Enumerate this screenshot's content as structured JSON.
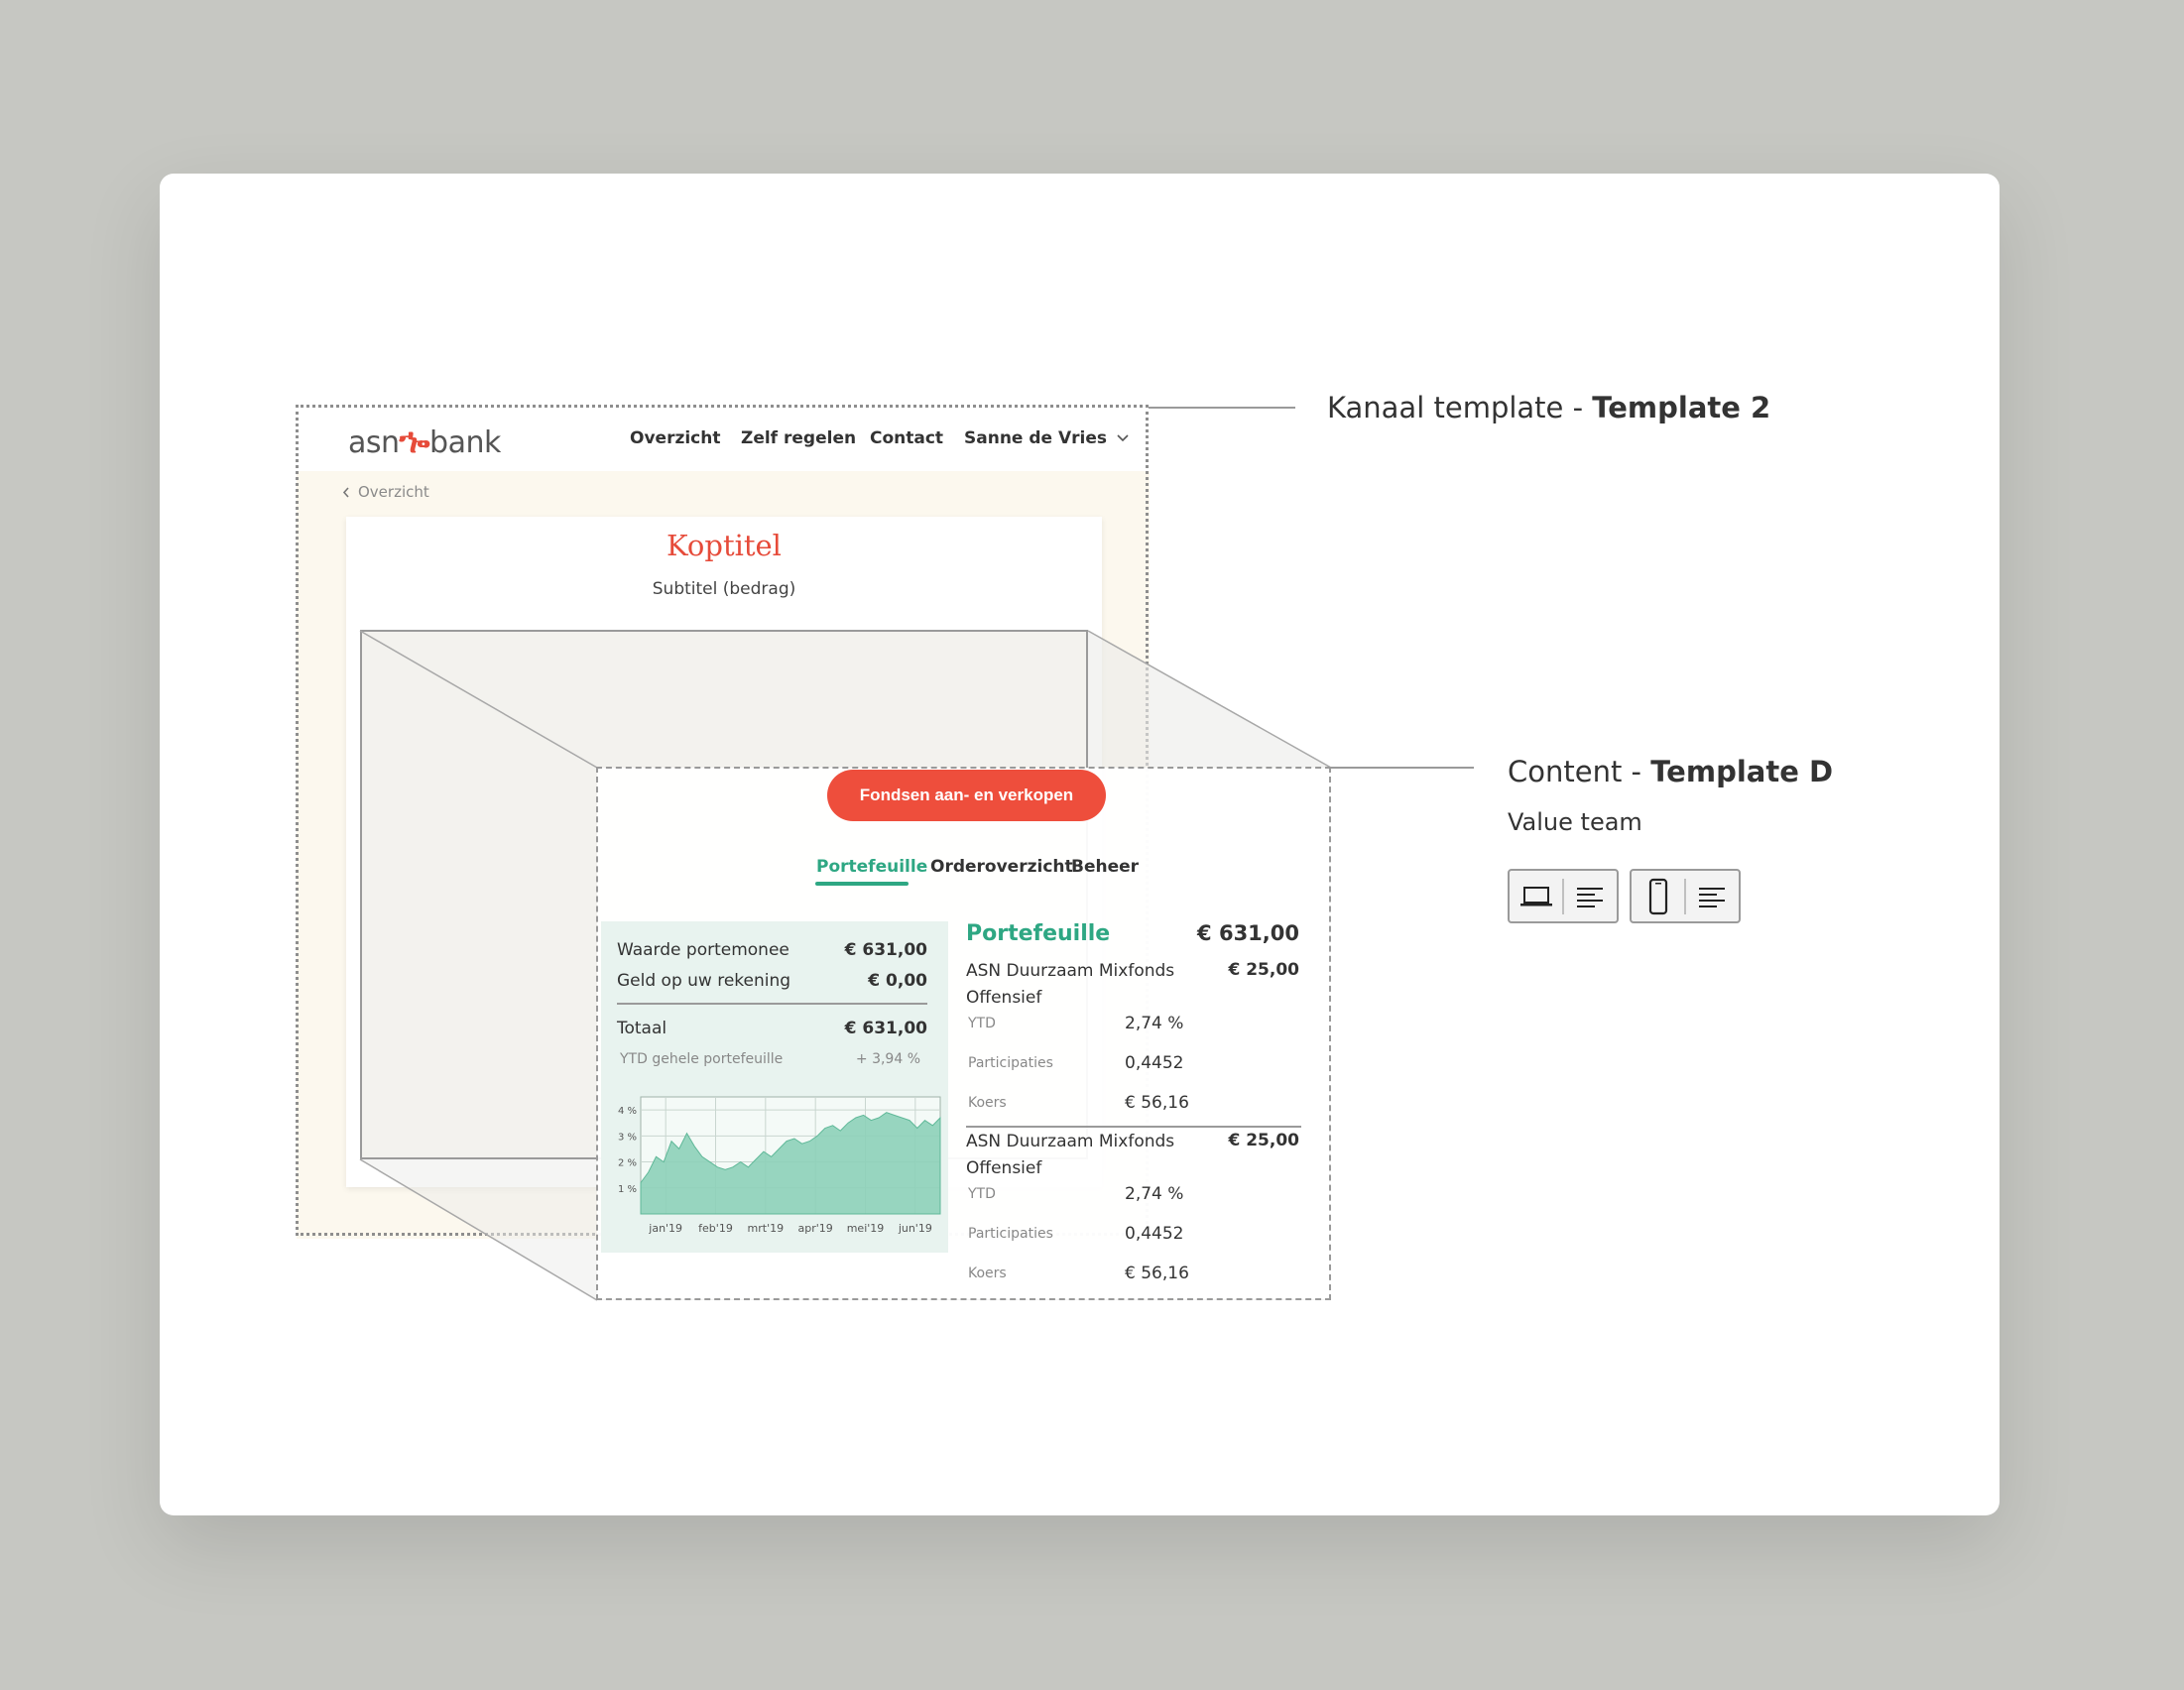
{
  "browser": {
    "logo_left": "asn",
    "logo_right": "bank",
    "nav": [
      "Overzicht",
      "Zelf regelen",
      "Contact",
      "Sanne de Vries"
    ],
    "breadcrumb": "Overzicht",
    "title": "Koptitel",
    "subtitle": "Subtitel (bedrag)"
  },
  "content": {
    "cta_label": "Fondsen aan- en verkopen",
    "tabs": [
      "Portefeuille",
      "Orderoverzicht",
      "Beheer"
    ],
    "active_tab": 0,
    "summary": {
      "rows": [
        {
          "label": "Waarde portemonee",
          "value": "€ 631,00"
        },
        {
          "label": "Geld op uw rekening",
          "value": "€ 0,00"
        }
      ],
      "total_label": "Totaal",
      "total_value": "€ 631,00",
      "ytd_label": "YTD gehele portefeuille",
      "ytd_value": "+ 3,94 %"
    },
    "portfolio": {
      "title": "Portefeuille",
      "total": "€ 631,00",
      "funds": [
        {
          "name": "ASN Duurzaam Mixfonds Offensief",
          "amount": "€ 25,00",
          "ytd_label": "YTD",
          "ytd": "2,74 %",
          "part_label": "Participaties",
          "participaties": "0,4452",
          "koers_label": "Koers",
          "koers": "€ 56,16"
        },
        {
          "name": "ASN Duurzaam Mixfonds Offensief",
          "amount": "€ 25,00",
          "ytd_label": "YTD",
          "ytd": "2,74 %",
          "part_label": "Participaties",
          "participaties": "0,4452",
          "koers_label": "Koers",
          "koers": "€ 56,16"
        }
      ]
    }
  },
  "chart_data": {
    "type": "area",
    "categories": [
      "jan'19",
      "feb'19",
      "mrt'19",
      "apr'19",
      "mei'19",
      "jun'19"
    ],
    "yticks": [
      "4 %",
      "3 %",
      "2 %",
      "1 %"
    ],
    "ytick_values": [
      4,
      3,
      2,
      1
    ],
    "ylim": [
      0,
      4.5
    ],
    "values": [
      1.2,
      1.6,
      2.2,
      2.0,
      2.8,
      2.5,
      3.1,
      2.6,
      2.2,
      2.0,
      1.8,
      1.7,
      1.8,
      2.0,
      1.8,
      2.1,
      2.4,
      2.2,
      2.5,
      2.8,
      2.9,
      2.7,
      2.8,
      3.0,
      3.3,
      3.4,
      3.2,
      3.5,
      3.7,
      3.8,
      3.6,
      3.7,
      3.9,
      3.8,
      3.7,
      3.6,
      3.3,
      3.6,
      3.4,
      3.7
    ],
    "color": "#8dd0b8",
    "grid": true
  },
  "callouts": {
    "kanaal_prefix": "Kanaal template - ",
    "kanaal_bold": "Template 2",
    "content_prefix": "Content - ",
    "content_bold": "Template D",
    "team": "Value team",
    "device_icons": [
      "laptop-icon",
      "align-left-icon",
      "phone-icon",
      "align-left-icon"
    ]
  },
  "colors": {
    "accent": "#2ea783",
    "brand": "#ee4e3c"
  }
}
